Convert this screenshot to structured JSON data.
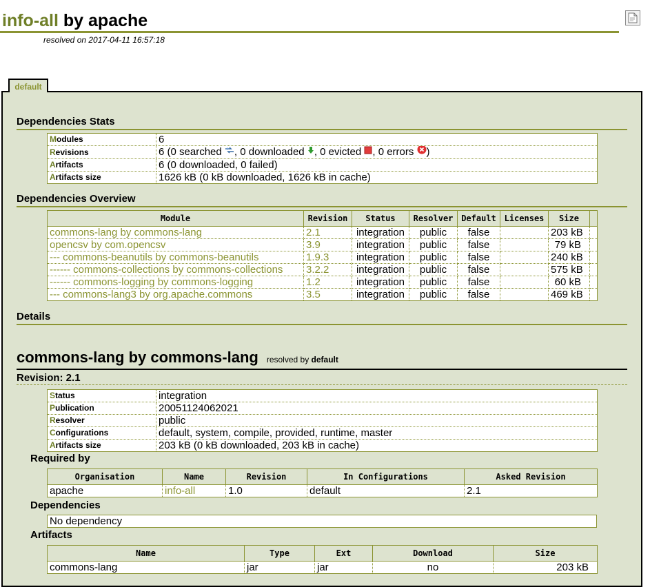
{
  "header": {
    "project": "info-all",
    "by": "by",
    "org": "apache",
    "resolved_on": "resolved on 2017-04-11 16:57:18"
  },
  "tab": {
    "label": "default"
  },
  "stats": {
    "heading": "Dependencies Stats",
    "rows": [
      {
        "key_first": "M",
        "key_rest": "odules",
        "value": "6"
      },
      {
        "key_first": "R",
        "key_rest": "evisions",
        "v_parts": [
          "6 (0 searched ",
          ", 0 downloaded ",
          ", 0 evicted ",
          ", 0 errors ",
          ")"
        ]
      },
      {
        "key_first": "A",
        "key_rest": "rtifacts",
        "value": "6 (0 downloaded, 0 failed)"
      },
      {
        "key_first": "A",
        "key_rest": "rtifacts size",
        "value": "1626 kB (0 kB downloaded, 1626 kB in cache)"
      }
    ]
  },
  "overview": {
    "heading": "Dependencies Overview",
    "columns": [
      "Module",
      "Revision",
      "Status",
      "Resolver",
      "Default",
      "Licenses",
      "Size"
    ],
    "rows": [
      {
        "module": "commons-lang by commons-lang",
        "revision": "2.1",
        "status": "integration",
        "resolver": "public",
        "default": "false",
        "licenses": "",
        "size": "203 kB"
      },
      {
        "module": "opencsv by com.opencsv",
        "revision": "3.9",
        "status": "integration",
        "resolver": "public",
        "default": "false",
        "licenses": "",
        "size": "79 kB"
      },
      {
        "module": "--- commons-beanutils by commons-beanutils",
        "revision": "1.9.3",
        "status": "integration",
        "resolver": "public",
        "default": "false",
        "licenses": "",
        "size": "240 kB"
      },
      {
        "module": "------ commons-collections by commons-collections",
        "revision": "3.2.2",
        "status": "integration",
        "resolver": "public",
        "default": "false",
        "licenses": "",
        "size": "575 kB"
      },
      {
        "module": "------ commons-logging by commons-logging",
        "revision": "1.2",
        "status": "integration",
        "resolver": "public",
        "default": "false",
        "licenses": "",
        "size": "60 kB"
      },
      {
        "module": "--- commons-lang3 by org.apache.commons",
        "revision": "3.5",
        "status": "integration",
        "resolver": "public",
        "default": "false",
        "licenses": "",
        "size": "469 kB"
      }
    ]
  },
  "details": {
    "heading": "Details",
    "module_title": "commons-lang by commons-lang",
    "resolved_by_label": "resolved by",
    "resolved_by": "default",
    "revision_title": "Revision: 2.1",
    "info": [
      {
        "key_first": "S",
        "key_rest": "tatus",
        "value": "integration"
      },
      {
        "key_first": "P",
        "key_rest": "ublication",
        "value": "20051124062021"
      },
      {
        "key_first": "R",
        "key_rest": "esolver",
        "value": "public"
      },
      {
        "key_first": "C",
        "key_rest": "onfigurations",
        "value": "default, system, compile, provided, runtime, master"
      },
      {
        "key_first": "A",
        "key_rest": "rtifacts size",
        "value": "203 kB (0 kB downloaded, 203 kB in cache)"
      }
    ],
    "required_by": {
      "heading": "Required by",
      "columns": [
        "Organisation",
        "Name",
        "Revision",
        "In Configurations",
        "Asked Revision"
      ],
      "rows": [
        {
          "organisation": "apache",
          "name": "info-all",
          "revision": "1.0",
          "configurations": "default",
          "asked": "2.1"
        }
      ]
    },
    "dependencies": {
      "heading": "Dependencies",
      "text": "No dependency"
    },
    "artifacts": {
      "heading": "Artifacts",
      "columns": [
        "Name",
        "Type",
        "Ext",
        "Download",
        "Size"
      ],
      "rows": [
        {
          "name": "commons-lang",
          "type": "jar",
          "ext": "jar",
          "download": "no",
          "size": "203 kB"
        }
      ]
    }
  },
  "icons": {
    "searched": "search-arrows-icon",
    "downloaded": "download-arrow-icon",
    "evicted": "evicted-square-icon",
    "errors": "error-x-icon",
    "xml": "xml-report-icon"
  },
  "colors": {
    "accent": "#8b9432",
    "panel": "#dde3cf",
    "link": "#8b9432",
    "evicted": "#e23c3c"
  }
}
